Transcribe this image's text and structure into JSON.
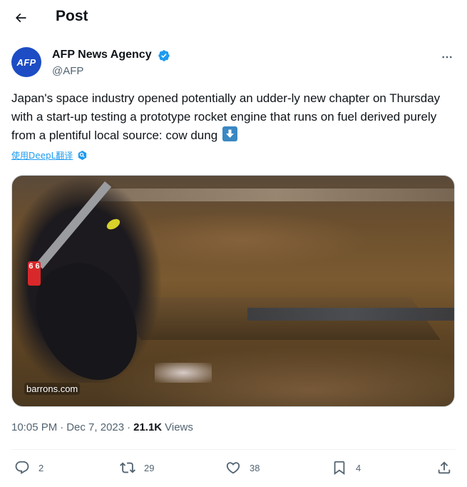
{
  "header": {
    "title": "Post",
    "back_icon": "arrow-left-icon"
  },
  "author": {
    "avatar_text": "AFP",
    "avatar_color": "#1d4cc4",
    "name": "AFP News Agency",
    "handle": "@AFP",
    "verified_color": "#1d9bf0"
  },
  "tweet": {
    "text": "Japan's space industry opened potentially an udder-ly new chapter on Thursday with a start-up testing a prototype rocket engine that runs on fuel derived purely from a plentiful local source: cow dung",
    "emoji": "down-arrow-emoji",
    "translate_label": "使用DeepL翻译"
  },
  "media": {
    "source": "barrons.com",
    "ear_tag_text": "6 6"
  },
  "meta": {
    "time": "10:05 PM",
    "date": "Dec 7, 2023",
    "separator": "·",
    "views_count": "21.1K",
    "views_label": "Views"
  },
  "actions": {
    "replies": "2",
    "reposts": "29",
    "likes": "38",
    "bookmarks": "4"
  },
  "colors": {
    "accent": "#1d9bf0",
    "text_primary": "#0f1419",
    "text_secondary": "#536471"
  }
}
